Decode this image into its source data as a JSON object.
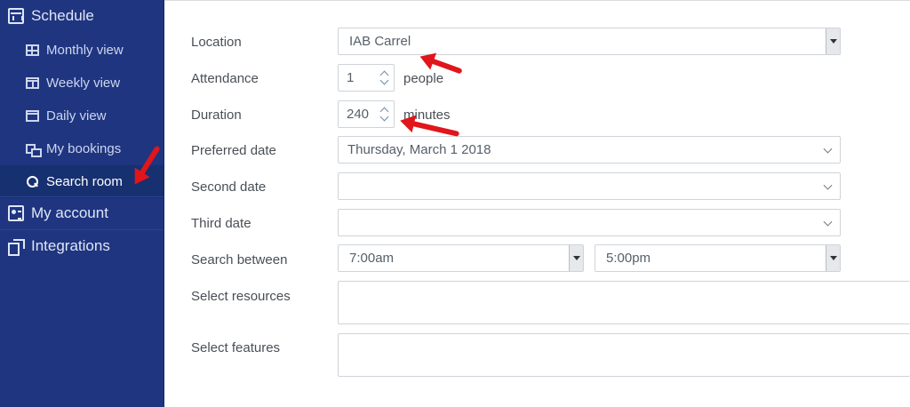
{
  "sidebar": {
    "schedule_label": "Schedule",
    "items": [
      {
        "label": "Monthly view"
      },
      {
        "label": "Weekly view"
      },
      {
        "label": "Daily view"
      },
      {
        "label": "My bookings"
      },
      {
        "label": "Search room"
      }
    ],
    "active_item": "Search room",
    "my_account_label": "My account",
    "integrations_label": "Integrations"
  },
  "form": {
    "location": {
      "label": "Location",
      "value": "IAB Carrel"
    },
    "attendance": {
      "label": "Attendance",
      "value": "1",
      "unit": "people"
    },
    "duration": {
      "label": "Duration",
      "value": "240",
      "unit": "minutes"
    },
    "preferred_date": {
      "label": "Preferred date",
      "value": "Thursday, March 1 2018"
    },
    "second_date": {
      "label": "Second date",
      "value": ""
    },
    "third_date": {
      "label": "Third date",
      "value": ""
    },
    "search_between": {
      "label": "Search between",
      "start": "7:00am",
      "end": "5:00pm"
    },
    "select_resources": {
      "label": "Select resources",
      "value": ""
    },
    "select_features": {
      "label": "Select features",
      "value": ""
    }
  },
  "colors": {
    "sidebar_bg": "#1f3580",
    "sidebar_active_bg": "#173070",
    "annotation_arrow": "#e0161b"
  }
}
